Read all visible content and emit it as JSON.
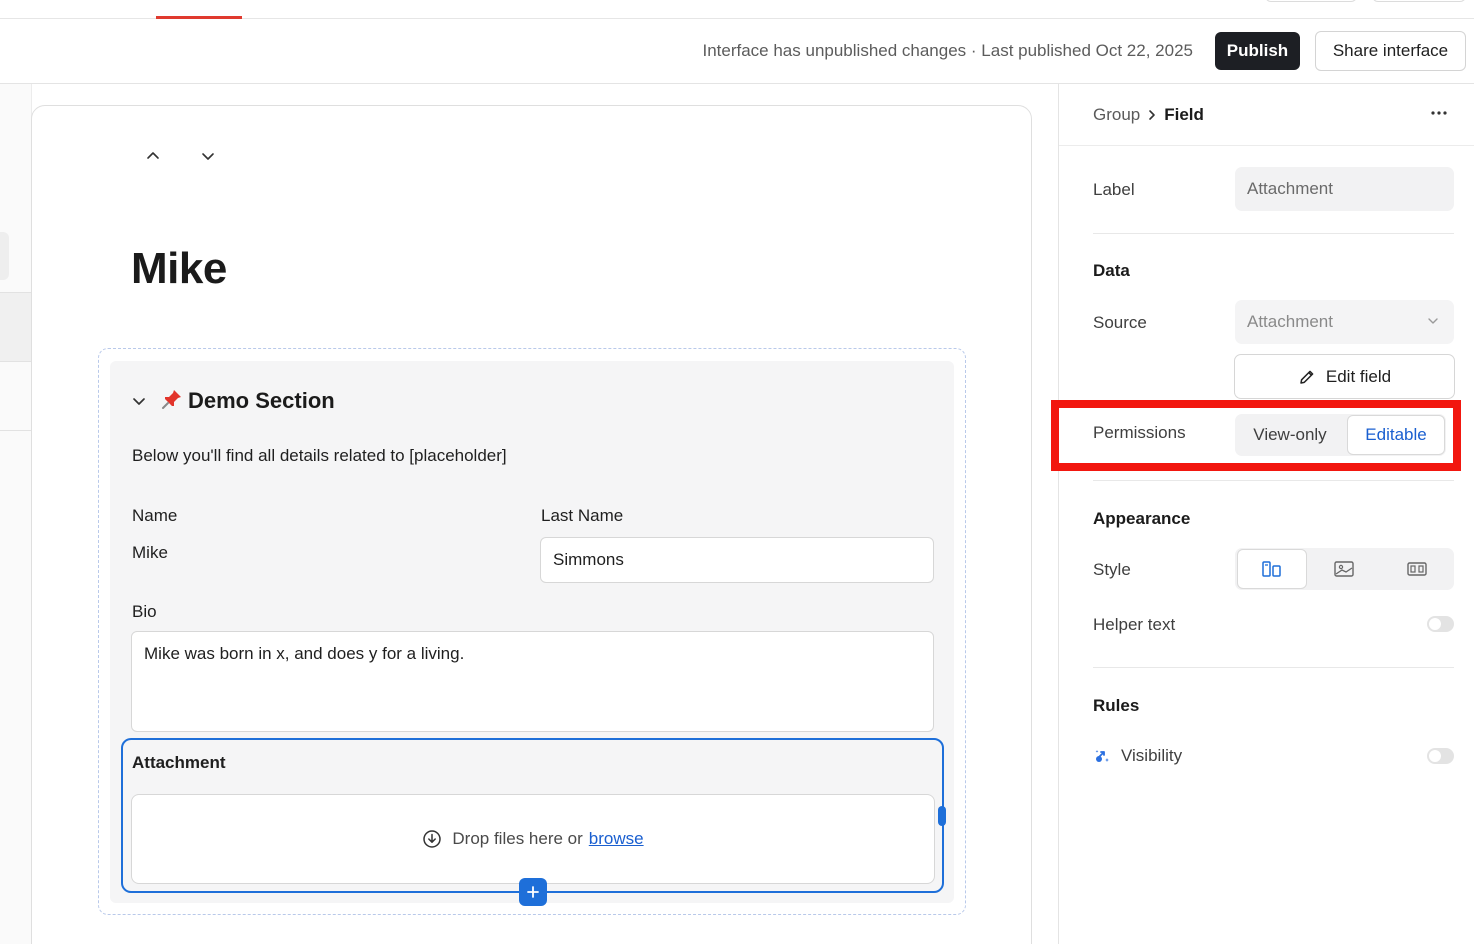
{
  "header": {
    "status_text": "Interface has unpublished changes · Last published Oct 22, 2025",
    "publish_label": "Publish",
    "share_label": "Share interface"
  },
  "record": {
    "title": "Mike"
  },
  "section": {
    "title": "Demo Section",
    "description": "Below you'll find all details related to [placeholder]",
    "fields": {
      "name_label": "Name",
      "name_value": "Mike",
      "last_name_label": "Last Name",
      "last_name_value": "Simmons",
      "bio_label": "Bio",
      "bio_value": "Mike was born in x, and does y for a living.",
      "attachment_label": "Attachment",
      "drop_text": "Drop files here or",
      "browse_link": "browse"
    }
  },
  "panel": {
    "breadcrumb_group": "Group",
    "breadcrumb_field": "Field",
    "label_label": "Label",
    "label_value": "Attachment",
    "data_heading": "Data",
    "source_label": "Source",
    "source_value": "Attachment",
    "edit_field_label": "Edit field",
    "permissions_label": "Permissions",
    "permissions_options": [
      "View-only",
      "Editable"
    ],
    "permissions_selected": "Editable",
    "appearance_heading": "Appearance",
    "style_label": "Style",
    "helper_text_label": "Helper text",
    "helper_text_enabled": false,
    "rules_heading": "Rules",
    "visibility_label": "Visibility",
    "visibility_enabled": false
  },
  "colors": {
    "accent_blue": "#1e6fd9",
    "highlight_red": "#f2170f",
    "publish_bg": "#1d1f24",
    "tab_underline": "#e03a2f"
  }
}
